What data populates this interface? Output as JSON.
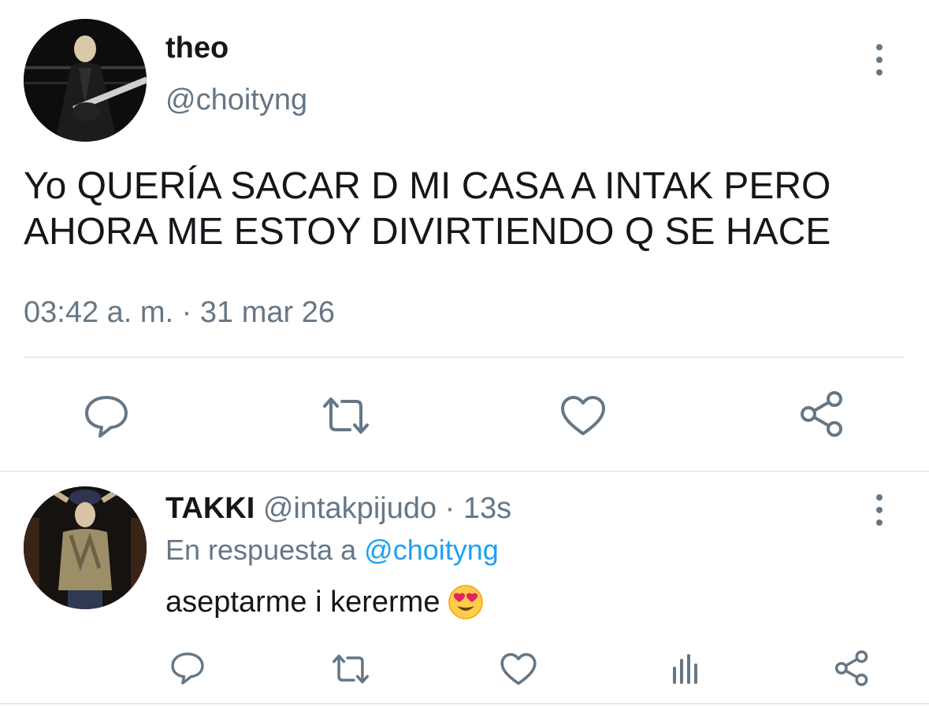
{
  "tweet": {
    "display_name": "theo",
    "handle": "@choityng",
    "text_line1": "Yo QUERÍA SACAR D MI CASA A INTAK PERO",
    "text_line2": "AHORA ME ESTOY DIVIRTIENDO Q SE HACE",
    "time": "03:42 a. m. · 31 mar 26",
    "actions": [
      "reply-icon",
      "retweet-icon",
      "like-icon",
      "share-icon"
    ]
  },
  "reply": {
    "display_name": "TAKKI",
    "handle": "@intakpijudo",
    "separator": "·",
    "age": "13s",
    "in_reply_to_prefix": "En respuesta a",
    "in_reply_to_handle": "@choityng",
    "text": "aseptarme i kererme",
    "emoji": "😍",
    "actions": [
      "reply-icon",
      "retweet-icon",
      "like-icon",
      "analytics-icon",
      "share-icon"
    ]
  },
  "colors": {
    "text": "#14171a",
    "secondary": "#657786",
    "link": "#1da1f2",
    "divider": "#e6ecf0"
  }
}
